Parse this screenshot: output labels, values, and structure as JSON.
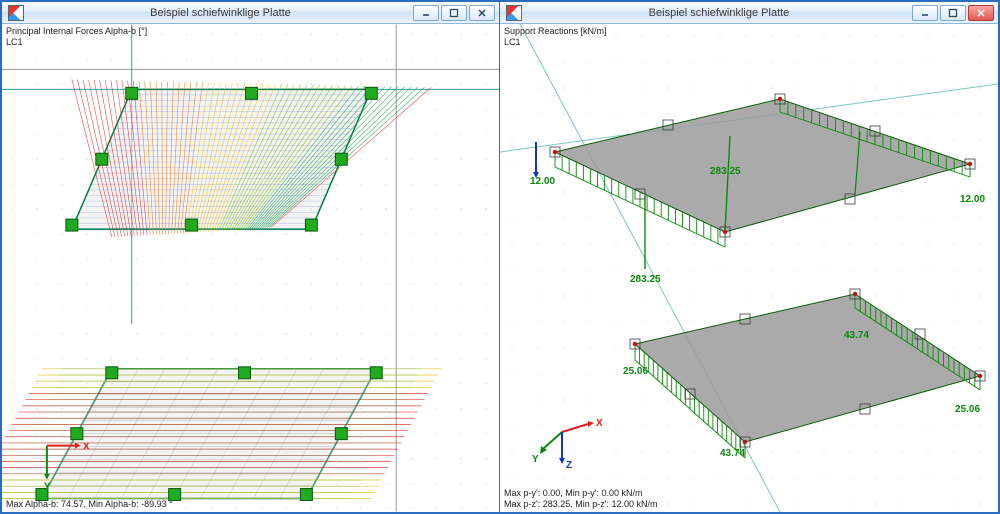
{
  "windows": {
    "left": {
      "title": "Beispiel schiefwinklige Platte",
      "info_top_line1": "Principal Internal Forces Alpha-b [°]",
      "info_top_line2": "LC1",
      "info_bottom": "Max Alpha-b: 74.57, Min Alpha-b: -89.93 °"
    },
    "right": {
      "title": "Beispiel schiefwinklige Platte",
      "info_top_line1": "Support Reactions [kN/m]",
      "info_top_line2": "LC1",
      "info_bottom_line1": "Max p-y': 0.00, Min p-y': 0.00 kN/m",
      "info_bottom_line2": "Max p-z': 283.25, Min p-z': 12.00 kN/m"
    }
  },
  "icons": {
    "minimize": "minimize-icon",
    "maximize": "maximize-icon",
    "close": "close-icon"
  },
  "left_axes_top": {
    "x": "X",
    "y": "Y"
  },
  "left_axes_bottom": {
    "x": "X",
    "y": "Y"
  },
  "right_axes_top": {
    "x": "X",
    "y": "Y",
    "z": "Z"
  },
  "right_axes_bottom": {
    "x": "X",
    "y": "Y",
    "z": "Z"
  },
  "reaction_values": {
    "top": {
      "left": "12.00",
      "mid_hi": "283.25",
      "mid_lo": "283.25",
      "right": "12.00"
    },
    "bottom": {
      "left": "25.06",
      "mid_hi": "43.74",
      "mid_lo": "43.74",
      "right": "25.06"
    }
  }
}
